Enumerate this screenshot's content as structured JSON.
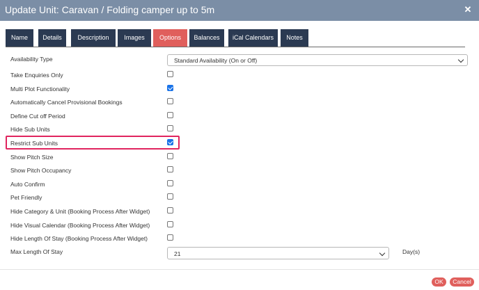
{
  "dialog": {
    "title": "Update Unit: Caravan / Folding camper up to 5m",
    "close_glyph": "✕"
  },
  "tabs": [
    {
      "label": "Name",
      "active": false
    },
    {
      "label": "Details",
      "active": false
    },
    {
      "label": "Description",
      "active": false
    },
    {
      "label": "Images",
      "active": false
    },
    {
      "label": "Options",
      "active": true
    },
    {
      "label": "Balances",
      "active": false
    },
    {
      "label": "iCal Calendars",
      "active": false
    },
    {
      "label": "Notes",
      "active": false
    }
  ],
  "availability_type": {
    "label": "Availability Type",
    "value": "Standard Availability (On or Off)"
  },
  "options": [
    {
      "label": "Take Enquiries Only",
      "checked": false
    },
    {
      "label": "Multi Plot Functionality",
      "checked": true
    },
    {
      "label": "Automatically Cancel Provisional Bookings",
      "checked": false
    },
    {
      "label": "Define Cut off Period",
      "checked": false
    },
    {
      "label": "Hide Sub Units",
      "checked": false
    },
    {
      "label": "Restrict Sub Units",
      "checked": true
    },
    {
      "label": "Show Pitch Size",
      "checked": false
    },
    {
      "label": "Show Pitch Occupancy",
      "checked": false
    },
    {
      "label": "Auto Confirm",
      "checked": false
    },
    {
      "label": "Pet Friendly",
      "checked": false
    },
    {
      "label": "Hide Category & Unit (Booking Process After Widget)",
      "checked": false
    },
    {
      "label": "Hide Visual Calendar (Booking Process After Widget)",
      "checked": false
    },
    {
      "label": "Hide Length Of Stay (Booking Process After Widget)",
      "checked": false
    }
  ],
  "max_stay": {
    "label": "Max Length Of Stay",
    "value": "21",
    "unit": "Day(s)"
  },
  "buttons": {
    "ok": "OK",
    "cancel": "Cancel"
  },
  "colors": {
    "titlebar": "#7b8ea6",
    "tab": "#2b3a52",
    "tab_active": "#e05f5c",
    "checkbox_checked": "#1a73e8",
    "highlight": "#e0245e",
    "button": "#e05f5c"
  }
}
